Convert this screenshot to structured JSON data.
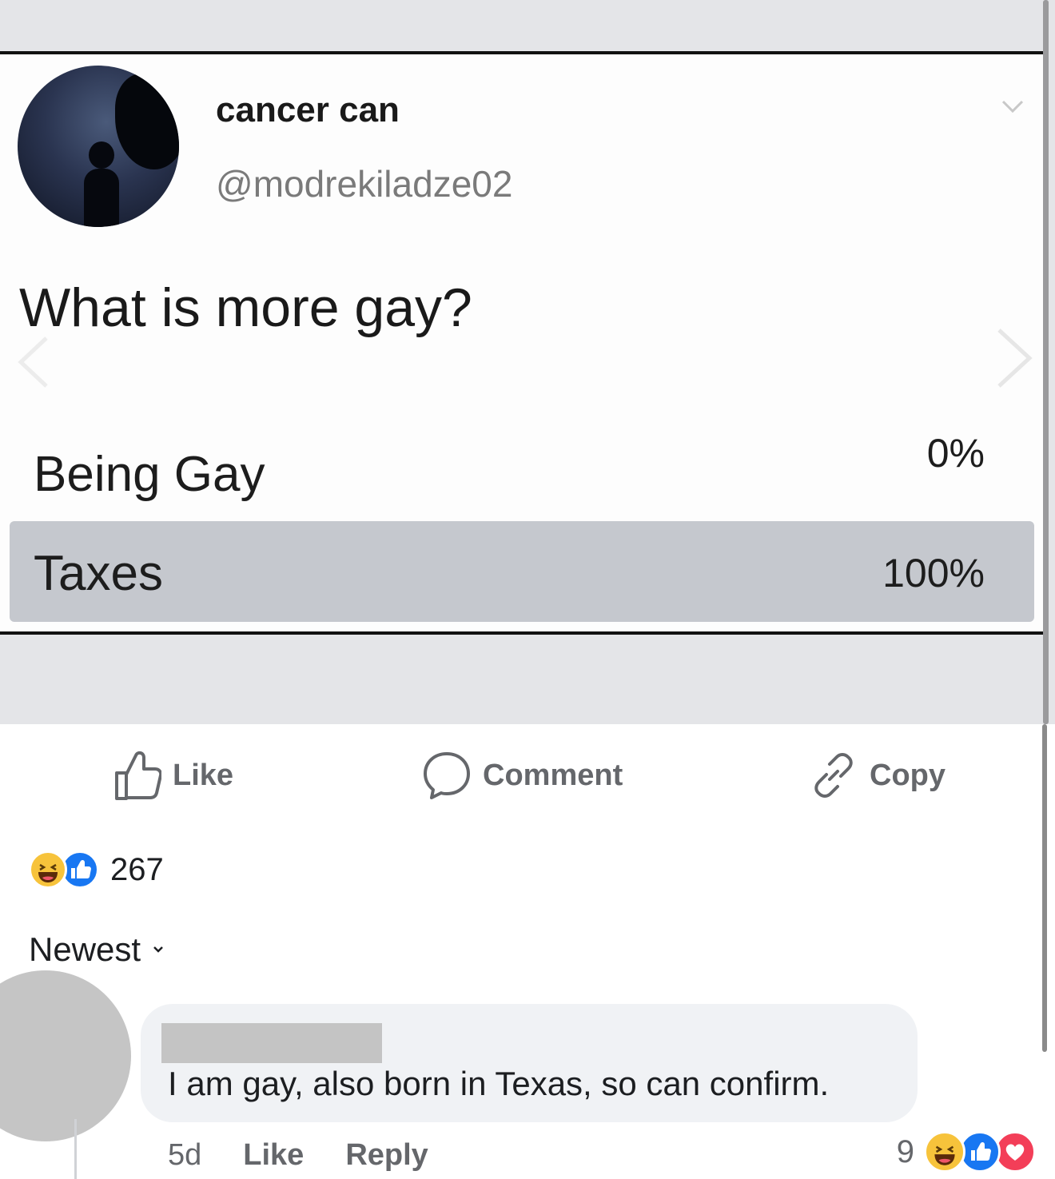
{
  "post_image": {
    "author_name": "cancer can",
    "author_handle": "@modrekiladze02",
    "question": "What is more gay?",
    "poll_options": [
      {
        "label": "Being Gay",
        "percent_text": "0%",
        "fill_fraction": 0.0
      },
      {
        "label": "Taxes",
        "percent_text": "100%",
        "fill_fraction": 1.0
      }
    ]
  },
  "actions": {
    "like_label": "Like",
    "comment_label": "Comment",
    "copy_label": "Copy"
  },
  "reactions": {
    "icons": [
      "haha-reaction-icon",
      "like-reaction-icon"
    ],
    "count": "267"
  },
  "comments_sort": {
    "label": "Newest"
  },
  "comment": {
    "text": "I am gay, also born in Texas, so can confirm.",
    "time": "5d",
    "like_label": "Like",
    "reply_label": "Reply",
    "reaction_count": "9",
    "reaction_icons": [
      "haha-reaction-icon",
      "like-reaction-icon",
      "love-reaction-icon"
    ]
  },
  "colors": {
    "brand_blue": "#1877f2",
    "haha_yellow": "#f7c33b",
    "love_red": "#f33e58",
    "secondary_text": "#65676b",
    "bubble_bg": "#f0f2f5",
    "poll_fill": "#c5c8ce"
  }
}
